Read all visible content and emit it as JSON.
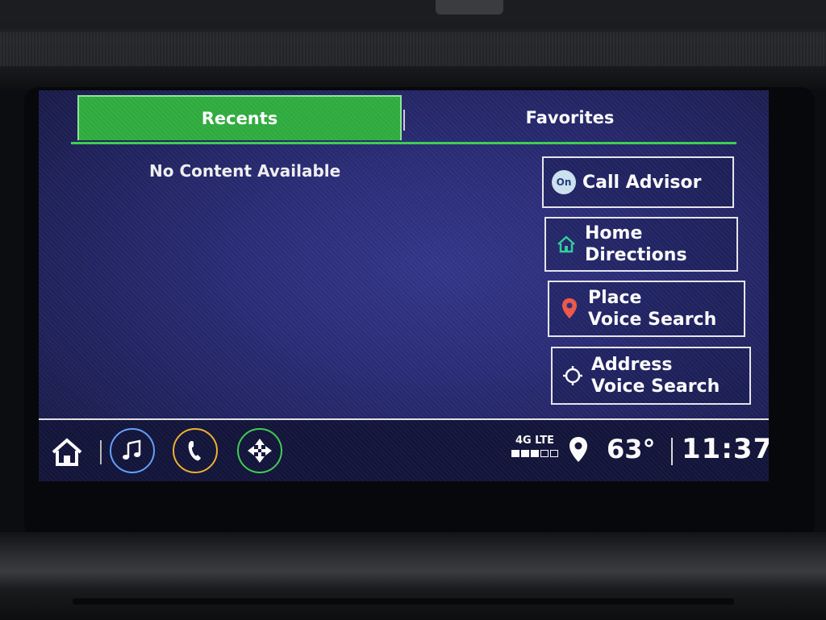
{
  "tabs": [
    {
      "label": "Recents",
      "selected": true
    },
    {
      "label": "Favorites",
      "selected": false
    }
  ],
  "recents": {
    "empty_message": "No Content Available"
  },
  "actions": {
    "call_advisor": {
      "label": "Call Advisor",
      "icon": "onstar-icon",
      "badge": "On"
    },
    "home_directions": {
      "line1": "Home",
      "line2": "Directions",
      "icon": "home-icon"
    },
    "place_voice_search": {
      "line1": "Place",
      "line2": "Voice Search",
      "icon": "location-pin-icon"
    },
    "address_voice_search": {
      "line1": "Address",
      "line2": "Voice Search",
      "icon": "crosshair-icon"
    }
  },
  "status_bar": {
    "network": "4G LTE",
    "signal_level": 0.6,
    "temperature": "63°",
    "time": "11:37"
  },
  "apps": [
    {
      "name": "audio",
      "icon": "music-note-icon",
      "color": "#5fa3ff"
    },
    {
      "name": "phone",
      "icon": "phone-icon",
      "color": "#f0b42a"
    },
    {
      "name": "navigation",
      "icon": "nav-arrows-icon",
      "color": "#3dd153"
    }
  ],
  "colors": {
    "accent_green": "#2fae3f",
    "background": "#2a2c78"
  }
}
